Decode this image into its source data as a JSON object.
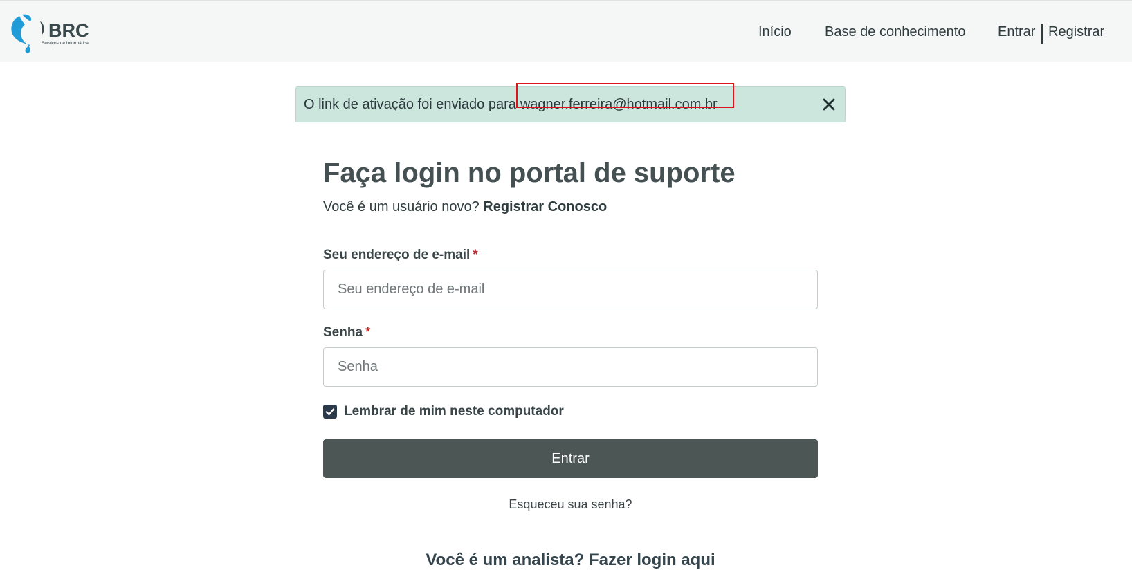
{
  "header": {
    "logo": {
      "text": "BRC",
      "tagline": "Serviços de Informática",
      "colors": {
        "swoosh": "#1f9bd7",
        "text": "#3a4a4c"
      }
    },
    "nav": {
      "inicio": "Início",
      "base": "Base de conhecimento",
      "entrar": "Entrar",
      "registrar": "Registrar"
    }
  },
  "alert": {
    "message": "O link de ativação foi enviado para",
    "email": "wagner.ferreira@hotmail.com.br",
    "close_icon": "close-icon"
  },
  "login": {
    "title": "Faça login no portal de suporte",
    "new_user_prompt": "Você é um usuário novo?",
    "register_link": "Registrar Conosco",
    "email_label": "Seu endereço de e-mail",
    "email_placeholder": "Seu endereço de e-mail",
    "password_label": "Senha",
    "password_placeholder": "Senha",
    "required_mark": "*",
    "remember_label": "Lembrar de mim neste computador",
    "remember_checked": true,
    "submit_label": "Entrar",
    "forgot_link": "Esqueceu sua senha?",
    "analyst_prompt": "Você é um analista?",
    "analyst_link": "Fazer login aqui"
  },
  "colors": {
    "alert_bg": "#cce5dd",
    "highlight_border": "#e0131a",
    "button_bg": "#4b5655",
    "required": "#c0272d",
    "checkbox": "#2b3a4a"
  }
}
